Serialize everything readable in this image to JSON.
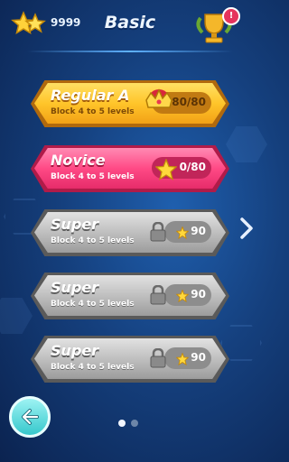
{
  "header": {
    "coins": "9999",
    "title": "Basic",
    "notification_badge": "!"
  },
  "levels": [
    {
      "name": "Regular A",
      "subtitle": "Block 4 to 5 levels",
      "status": "80/80",
      "style": "gold",
      "icon": "crown-icon"
    },
    {
      "name": "Novice",
      "subtitle": "Block 4 to 5 levels",
      "status": "0/80",
      "style": "pink",
      "icon": "star-icon"
    },
    {
      "name": "Super",
      "subtitle": "Block 4 to 5 levels",
      "status": "90",
      "style": "gray",
      "icon": "lock-icon"
    },
    {
      "name": "Super",
      "subtitle": "Block 4 to 5 levels",
      "status": "90",
      "style": "gray",
      "icon": "lock-icon"
    },
    {
      "name": "Super",
      "subtitle": "Block 4 to 5 levels",
      "status": "90",
      "style": "gray",
      "icon": "lock-icon"
    }
  ],
  "pagination": {
    "current": 1,
    "total": 2
  },
  "colors": {
    "background": "#15407e",
    "gold": "#ffc52a",
    "pink": "#ff4a86",
    "gray": "#bcbcbc",
    "accent": "#36c8cc"
  }
}
